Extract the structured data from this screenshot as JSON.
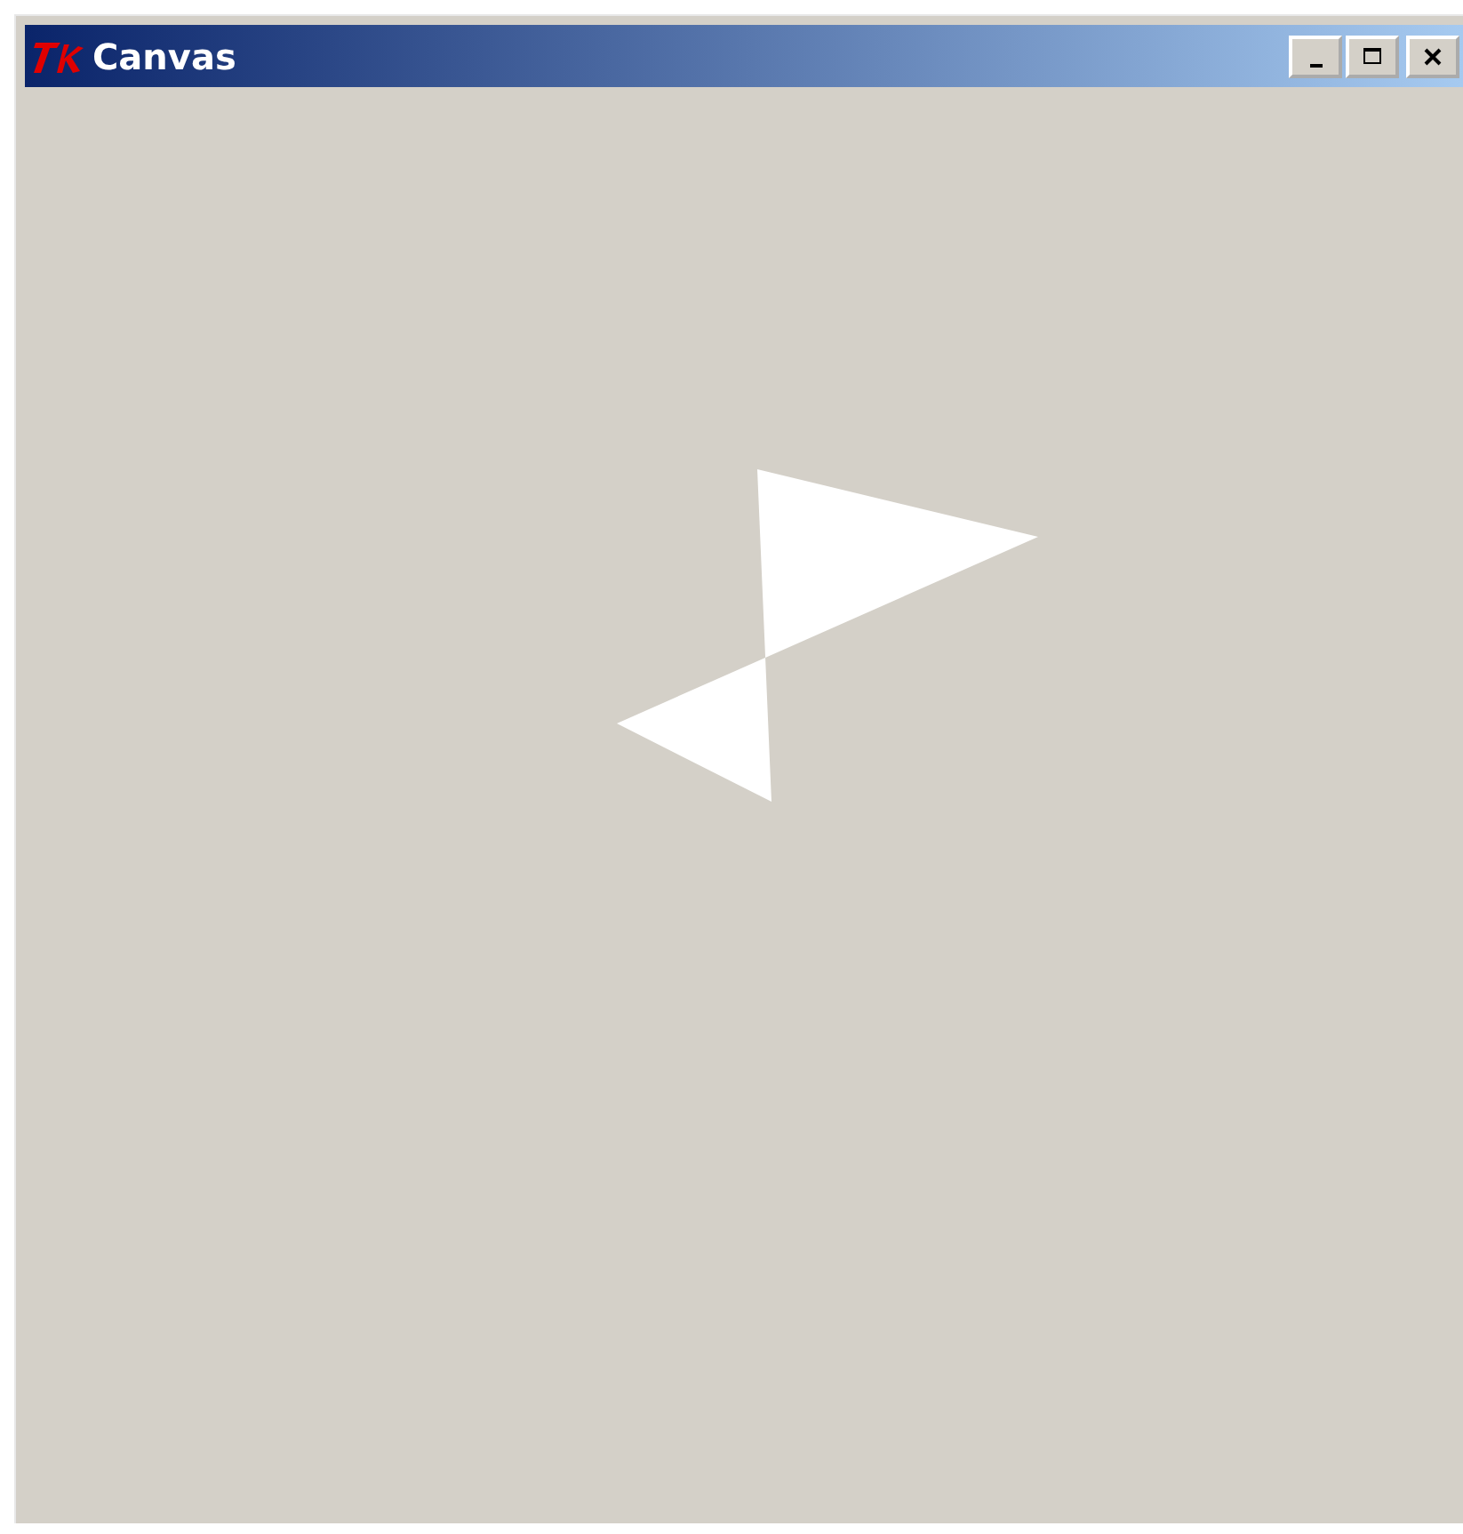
{
  "window": {
    "title": "Canvas"
  }
}
